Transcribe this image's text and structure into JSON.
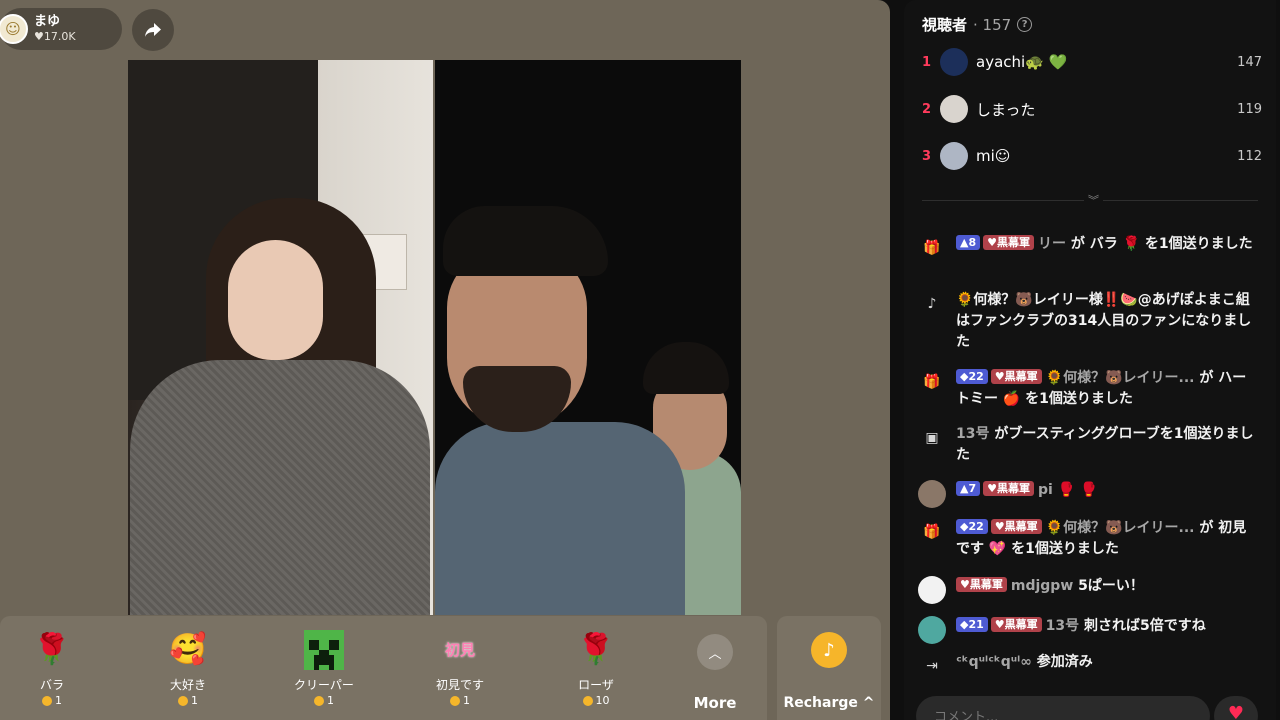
{
  "host": {
    "name": "まゆ",
    "likes": "17.0K",
    "avatar_icon": "sun-face-icon"
  },
  "share": {
    "icon": "share-arrow-icon"
  },
  "gifts": [
    {
      "name": "バラ",
      "price": "1",
      "icon": "rose-icon",
      "glyph": "🌹"
    },
    {
      "name": "大好き",
      "price": "1",
      "icon": "heart-face-icon",
      "glyph": "🥰"
    },
    {
      "name": "クリーパー",
      "price": "1",
      "icon": "creeper-icon",
      "glyph": "▦"
    },
    {
      "name": "初見です",
      "price": "1",
      "icon": "first-time-sticker-icon",
      "glyph": "初見"
    },
    {
      "name": "ローザ",
      "price": "10",
      "icon": "rose-bundle-icon",
      "glyph": "🌹"
    }
  ],
  "more": {
    "label": "More",
    "icon": "chevron-up-icon"
  },
  "recharge": {
    "label": "Recharge ^",
    "icon": "tiktok-coin-icon"
  },
  "viewers": {
    "title": "視聴者",
    "count": "· 157"
  },
  "ranking": [
    {
      "rank": "1",
      "name": "ayachi🐢 💚",
      "score": "147",
      "avatar_color": "#1c2f5a"
    },
    {
      "rank": "2",
      "name": "しまった",
      "score": "119",
      "avatar_color": "#d9d4ce"
    },
    {
      "rank": "3",
      "name": "mi☺",
      "score": "112",
      "avatar_color": "#aeb6c4"
    }
  ],
  "chat": [
    {
      "icon": "gift-icon",
      "level": "8",
      "fan": "♥黒幕軍",
      "user": "リー",
      "text": "が バラ 🌹 を1個送りました"
    },
    {
      "icon": "tiktok-icon",
      "level": "",
      "fan": "",
      "user": "",
      "text": "🌻何様？🐻レイリー様‼️🍉@あげぽよまこ組はファンクラブの314人目のファンになりました"
    },
    {
      "icon": "gift-icon",
      "level": "22",
      "fan": "♥黒幕軍",
      "user": "🌻何様？🐻レイリー...",
      "text": "が ハートミー 🍎 を1個送りました"
    },
    {
      "icon": "boost-card-icon",
      "level": "",
      "fan": "",
      "user": "13号",
      "text": "がブースティンググローブを1個送りました"
    },
    {
      "icon": "user-avatar-pi",
      "level": "7",
      "fan": "♥黒幕軍",
      "user": "pi",
      "text": "🥊 🥊"
    },
    {
      "icon": "gift-icon",
      "level": "22",
      "fan": "♥黒幕軍",
      "user": "🌻何様？🐻レイリー...",
      "text": "が 初見です 💖 を1個送りました"
    },
    {
      "icon": "user-avatar-white",
      "level": "",
      "fan": "♥黒幕軍",
      "user": "mdjgpw",
      "text": "5ぱーい！"
    },
    {
      "icon": "user-avatar-teal",
      "level": "21",
      "fan": "♥黒幕軍",
      "user": "13号",
      "text": "刺されば5倍ですね"
    },
    {
      "icon": "join-icon",
      "level": "",
      "fan": "",
      "user": "ᶜᵏqᵘˡᶜᵏqᵘˡ∞",
      "text": "参加済み"
    }
  ],
  "composer": {
    "placeholder": "コメント..."
  },
  "colors": {
    "stage": "#6e6658",
    "panel": "#121212",
    "rank": "#ff3b5c",
    "level_badge": "#4e5bd3",
    "fan_badge": "#b0424a",
    "coin": "#f5b62b"
  }
}
